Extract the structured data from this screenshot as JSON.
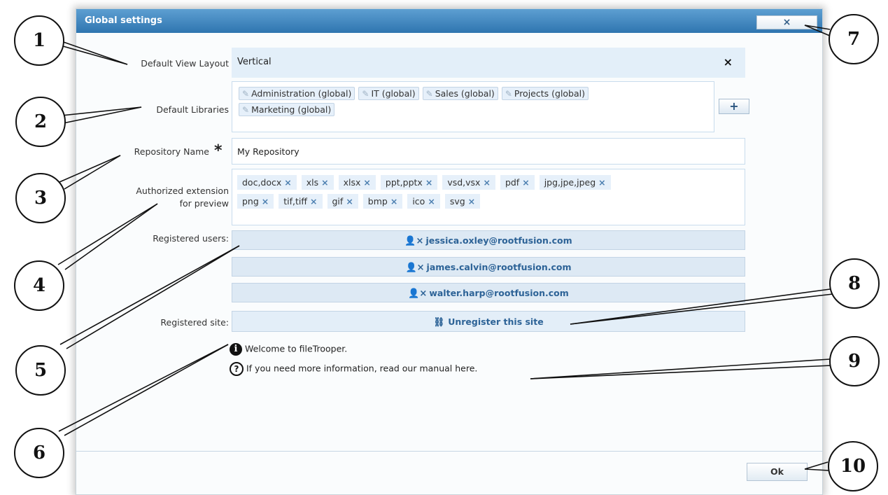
{
  "dialog": {
    "title": "Global settings",
    "close_label": "×",
    "ok_label": "Ok"
  },
  "fields": {
    "default_view_layout": {
      "label": "Default View Layout",
      "value": "Vertical",
      "clear": "×"
    },
    "default_libraries": {
      "label": "Default Libraries",
      "items": [
        "Administration (global)",
        "IT (global)",
        "Sales (global)",
        "Projects (global)",
        "Marketing (global)"
      ],
      "add_label": "+"
    },
    "repository_name": {
      "label": "Repository Name",
      "required_mark": "*",
      "value": "My Repository"
    },
    "authorized_extensions": {
      "label_line1": "Authorized extension",
      "label_line2": "for preview",
      "items": [
        "doc,docx",
        "xls",
        "xlsx",
        "ppt,pptx",
        "vsd,vsx",
        "pdf",
        "jpg,jpe,jpeg",
        "png",
        "tif,tiff",
        "gif",
        "bmp",
        "ico",
        "svg"
      ],
      "remove_mark": "×"
    },
    "registered_users": {
      "label": "Registered users:",
      "users": [
        "jessica.oxley@rootfusion.com",
        "james.calvin@rootfusion.com",
        "walter.harp@rootfusion.com"
      ]
    },
    "registered_site": {
      "label": "Registered site:",
      "button_label": "Unregister this site"
    }
  },
  "info": {
    "welcome": "Welcome to fileTrooper.",
    "help": "If you need more information, read our manual here."
  },
  "icons": {
    "edit": "edit-icon",
    "user_remove": "user-remove-icon",
    "unlink": "unlink-icon",
    "info": "info-icon",
    "help": "help-icon"
  },
  "callouts": [
    "1",
    "2",
    "3",
    "4",
    "5",
    "6",
    "7",
    "8",
    "9",
    "10"
  ],
  "colors": {
    "titlebar": "#3d84bf",
    "accent_text": "#2d6397",
    "field_bg": "#e3eff9"
  }
}
